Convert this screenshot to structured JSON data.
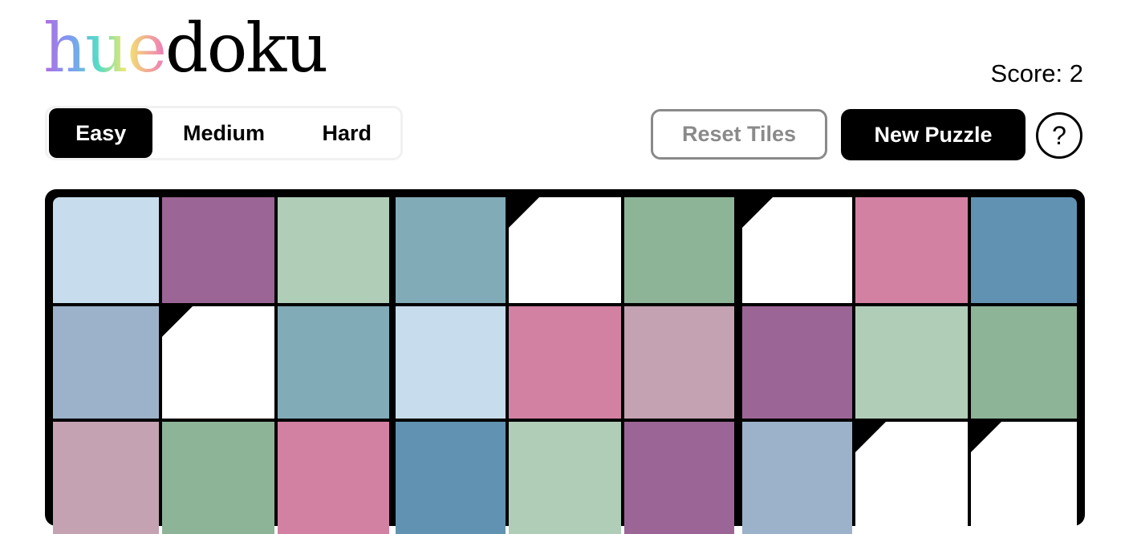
{
  "logo": {
    "part1": "hue",
    "part2": "doku"
  },
  "score": {
    "text": "Score: 2"
  },
  "difficulty": {
    "options": [
      "Easy",
      "Medium",
      "Hard"
    ],
    "selected": "Easy"
  },
  "actions": {
    "reset_label": "Reset Tiles",
    "new_label": "New Puzzle",
    "help_label": "?"
  },
  "colors": {
    "accent": "#000000",
    "disabled": "#8a8a8a",
    "empty_tile": "#ffffff"
  },
  "board": {
    "rows_visible": 3,
    "cols": 9,
    "tiles": [
      [
        "#c7dded",
        "#9b6596",
        "#b0cdb8",
        "#82abb8",
        null,
        "#8eb498",
        null,
        "#d381a3",
        "#6192b1"
      ],
      [
        "#9cb2ca",
        null,
        "#82abb8",
        "#c7dded",
        "#d381a3",
        "#c4a2b2",
        "#9b6596",
        "#b0cdb8",
        "#8eb498"
      ],
      [
        "#c4a2b2",
        "#8eb498",
        "#d381a3",
        "#6192b1",
        "#b0cdb8",
        "#9b6596",
        "#9cb2ca",
        null,
        null
      ]
    ]
  }
}
